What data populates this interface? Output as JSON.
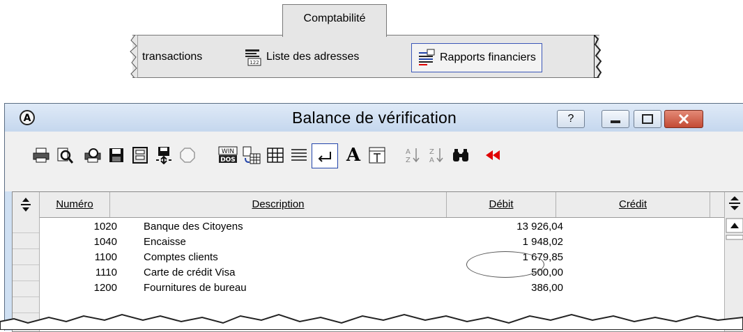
{
  "tabs": {
    "active_tab": "Comptabilité",
    "items": [
      {
        "label": "transactions"
      },
      {
        "label": "Liste des adresses"
      },
      {
        "label": "Rapports financiers"
      }
    ]
  },
  "window": {
    "title": "Balance de vérification",
    "buttons": {
      "help": "?"
    }
  },
  "toolbar": {
    "icons": [
      "print-icon",
      "preview-icon",
      "print-setup-icon",
      "save-icon",
      "columns-icon",
      "save-move-icon",
      "stop-icon",
      "win-dos-icon",
      "export-icon",
      "grid-icon",
      "lines-icon",
      "return-icon",
      "font-icon",
      "column-text-icon",
      "sort-az-icon",
      "sort-za-icon",
      "find-icon",
      "back-icon"
    ],
    "win_dos": [
      "WIN",
      "DOS"
    ],
    "font_letter": "A"
  },
  "table": {
    "columns": [
      "Numéro",
      "Description",
      "Débit",
      "Crédit"
    ],
    "rows": [
      {
        "num": "1020",
        "desc": "Banque des Citoyens",
        "debit": "13 926,04"
      },
      {
        "num": "1040",
        "desc": "Encaisse",
        "debit": "1 948,02"
      },
      {
        "num": "1100",
        "desc": "Comptes clients",
        "debit": "1 679,85"
      },
      {
        "num": "1110",
        "desc": "Carte de crédit Visa",
        "debit": "500,00"
      },
      {
        "num": "1200",
        "desc": "Fournitures de bureau",
        "debit": "386,00"
      }
    ]
  },
  "colors": {
    "accent": "#2244aa",
    "back_arrows": "#e00000",
    "title_bg": "#cfe0f3"
  }
}
